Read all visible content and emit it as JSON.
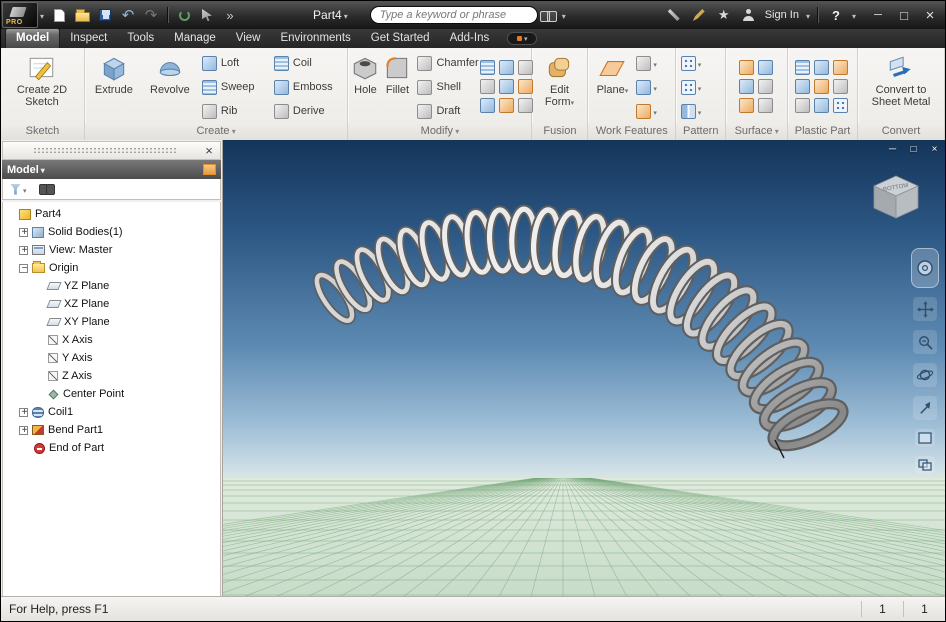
{
  "window": {
    "app_badge": "PRO",
    "document_title": "Part4",
    "search_placeholder": "Type a keyword or phrase",
    "sign_in_label": "Sign In"
  },
  "tabs": {
    "model": "Model",
    "inspect": "Inspect",
    "tools": "Tools",
    "manage": "Manage",
    "view": "View",
    "environments": "Environments",
    "get_started": "Get Started",
    "add_ins": "Add-Ins"
  },
  "ribbon": {
    "sketch": {
      "panel": "Sketch",
      "create_2d_sketch": "Create 2D Sketch"
    },
    "create": {
      "panel": "Create",
      "extrude": "Extrude",
      "revolve": "Revolve",
      "loft": "Loft",
      "sweep": "Sweep",
      "rib": "Rib",
      "coil": "Coil",
      "emboss": "Emboss",
      "derive": "Derive"
    },
    "modify": {
      "panel": "Modify",
      "hole": "Hole",
      "fillet": "Fillet",
      "chamfer": "Chamfer",
      "shell": "Shell",
      "draft": "Draft"
    },
    "fusion": {
      "panel": "Fusion",
      "edit_form": "Edit Form"
    },
    "work_features": {
      "panel": "Work Features",
      "plane": "Plane"
    },
    "pattern": {
      "panel": "Pattern"
    },
    "surface": {
      "panel": "Surface"
    },
    "plastic_part": {
      "panel": "Plastic Part"
    },
    "convert": {
      "panel": "Convert",
      "convert_to_sheet_metal": "Convert to Sheet Metal"
    }
  },
  "browser": {
    "title": "Model",
    "tree": {
      "part": "Part4",
      "solid_bodies": "Solid Bodies(1)",
      "view_master": "View: Master",
      "origin": "Origin",
      "yz_plane": "YZ Plane",
      "xz_plane": "XZ Plane",
      "xy_plane": "XY Plane",
      "x_axis": "X Axis",
      "y_axis": "Y Axis",
      "z_axis": "Z Axis",
      "center_point": "Center Point",
      "coil": "Coil1",
      "bend_part": "Bend Part1",
      "end_of_part": "End of Part"
    }
  },
  "viewport": {
    "viewcube_face": "BOTTOM",
    "spring": {
      "loops": 26,
      "color_dark": "#5f5f5f",
      "color_light": "#f0f0f0"
    }
  },
  "status": {
    "help": "For Help, press F1",
    "field1": "1",
    "field2": "1"
  }
}
